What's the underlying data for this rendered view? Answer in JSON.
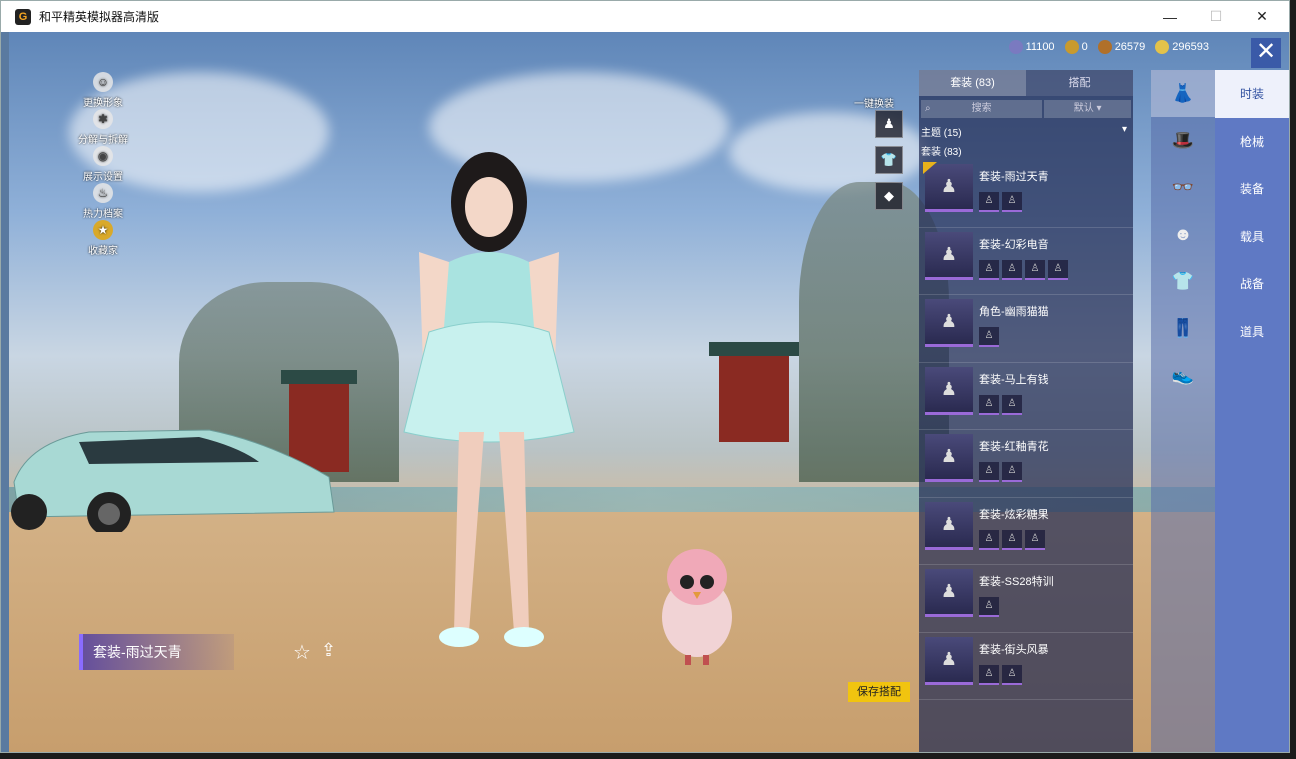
{
  "window": {
    "title": "和平精英模拟器高清版",
    "minimize": "—",
    "maximize": "☐",
    "close": "✕"
  },
  "left_menu": [
    {
      "label": "更换形象",
      "icon": "person-icon"
    },
    {
      "label": "分解与拆解",
      "icon": "gear-icon"
    },
    {
      "label": "展示设置",
      "icon": "eye-icon"
    },
    {
      "label": "热力档案",
      "icon": "flame-icon"
    },
    {
      "label": "收藏家",
      "icon": "medal-icon"
    }
  ],
  "currency": [
    {
      "value": "11100",
      "icon": "coin-blue-icon",
      "color": "#7a7ac0"
    },
    {
      "value": "0",
      "icon": "coin-gold-icon",
      "color": "#c89a2e"
    },
    {
      "value": "26579",
      "icon": "coin-bronze-icon",
      "color": "#b0702a"
    },
    {
      "value": "296593",
      "icon": "coin-yellow-icon",
      "color": "#e3c24a"
    }
  ],
  "quick_tools": {
    "one_click_label": "一键换装"
  },
  "panel": {
    "tabs": [
      "套装 (83)",
      "搭配"
    ],
    "search_placeholder": "搜索",
    "sort_label": "默认",
    "group_theme": "主题 (15)",
    "group_suits": "套装 (83)",
    "items": [
      {
        "name": "套装-雨过天青",
        "subs": 2,
        "selected": true
      },
      {
        "name": "套装-幻彩电音",
        "subs": 4,
        "selected": false
      },
      {
        "name": "角色-幽雨猫猫",
        "subs": 1,
        "selected": false
      },
      {
        "name": "套装-马上有钱",
        "subs": 2,
        "selected": false
      },
      {
        "name": "套装-红釉青花",
        "subs": 2,
        "selected": false
      },
      {
        "name": "套装-炫彩糖果",
        "subs": 3,
        "selected": false
      },
      {
        "name": "套装-SS28特训",
        "subs": 1,
        "selected": false
      },
      {
        "name": "套装-街头风暴",
        "subs": 2,
        "selected": false
      }
    ]
  },
  "categories": [
    "时装",
    "枪械",
    "装备",
    "载具",
    "战备",
    "道具"
  ],
  "current_outfit": "套装-雨过天青",
  "save_button": "保存搭配",
  "colors": {
    "accent": "#5f79c4",
    "save": "#f1c40f",
    "rarity": "#9a6ad8"
  }
}
